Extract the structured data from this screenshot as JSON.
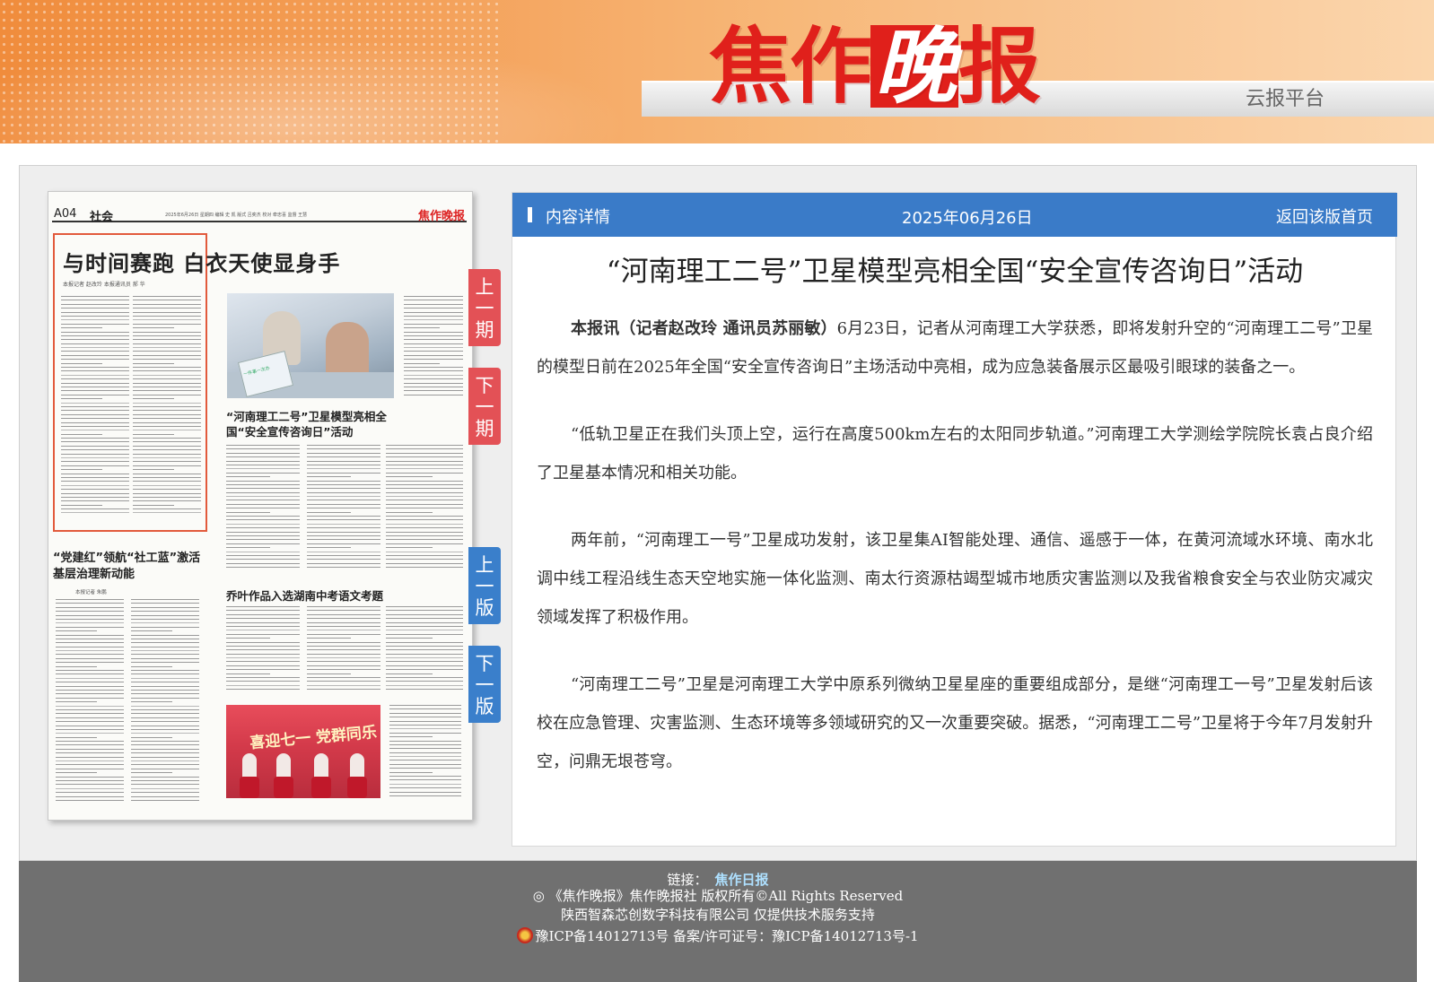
{
  "header": {
    "logo_chars": [
      "焦",
      "作",
      "晚",
      "报"
    ],
    "platform": "云报平台",
    "brand_color": "#e0201b"
  },
  "paper": {
    "page_no": "A04",
    "section": "社会",
    "meta": "2025年6月26日  星期四  编辑 史 凯  版式 吕奕杰  校对 牵忠喜  监督 王慧",
    "mini_logo": "焦作晚报",
    "headline1": "与时间赛跑 白衣天使显身手",
    "byline1": "本报记者 赵改玲  本报通讯员 郝 华",
    "caption1": "“河南理工二号”卫星模型亮相全国“安全宣传咨询日”活动",
    "story2_title": "“党建红”领航“社工蓝”激活基层治理新动能",
    "story2_byline": "本报记者 朱鹏",
    "story3_title": "乔叶作品入选湖南中考语文考题",
    "photo1_sign": "一件事一次办",
    "photo2_banner": "喜迎七一 党群同乐"
  },
  "nav": {
    "prev_issue": "上一期",
    "next_issue": "下一期",
    "prev_page": "上一版",
    "next_page": "下一版"
  },
  "article": {
    "bar_label": "内容详情",
    "date": "2025年06月26日",
    "back_link": "返回该版首页",
    "bar_color": "#3a7bc8",
    "title": "“河南理工二号”卫星模型亮相全国“安全宣传咨询日”活动",
    "p1_lead": "本报讯（记者赵改玲  通讯员苏丽敏）",
    "p1_rest": "6月23日，记者从河南理工大学获悉，即将发射升空的“河南理工二号”卫星的模型日前在2025年全国“安全宣传咨询日”主场活动中亮相，成为应急装备展示区最吸引眼球的装备之一。",
    "p2": "“低轨卫星正在我们头顶上空，运行在高度500km左右的太阳同步轨道。”河南理工大学测绘学院院长袁占良介绍了卫星基本情况和相关功能。",
    "p3": "两年前，“河南理工一号”卫星成功发射，该卫星集AI智能处理、通信、遥感于一体，在黄河流域水环境、南水北调中线工程沿线生态天空地实施一体化监测、南太行资源枯竭型城市地质灾害监测以及我省粮食安全与农业防灾减灾领域发挥了积极作用。",
    "p4": "“河南理工二号”卫星是河南理工大学中原系列微纳卫星星座的重要组成部分，是继“河南理工一号”卫星发射后该校在应急管理、灾害监测、生态环境等多领域研究的又一次重要突破。据悉，“河南理工二号”卫星将于今年7月发射升空，问鼎无垠苍穹。"
  },
  "footer": {
    "link_label": "链接：",
    "link_text": "焦作日报",
    "copyright": "◎ 《焦作晚报》焦作晚报社  版权所有©All Rights Reserved",
    "tech": "陕西智森芯创数字科技有限公司 仅提供技术服务支持",
    "icp": "豫ICP备14012713号 备案/许可证号：豫ICP备14012713号-1"
  }
}
